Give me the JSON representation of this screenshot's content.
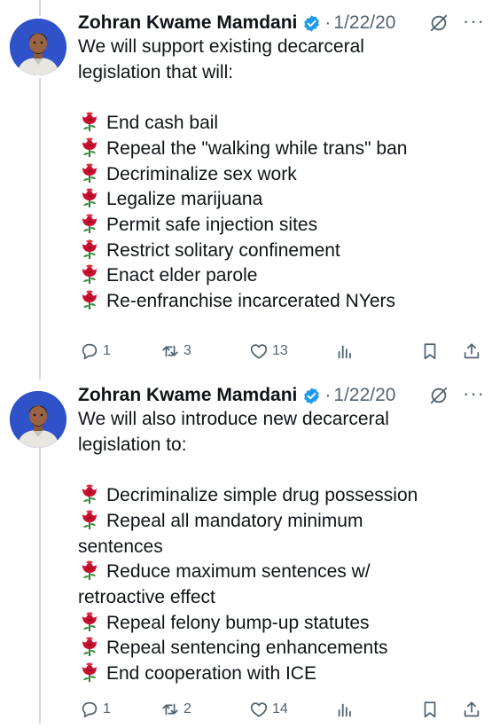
{
  "tweets": [
    {
      "author": "Zohran Kwame Mamdani",
      "date": "1/22/20",
      "separator": "·",
      "more": "···",
      "intro_lines": [
        "We will support existing decarceral",
        "legislation that will:"
      ],
      "items": [
        [
          "End cash bail"
        ],
        [
          "Repeal the \"walking while trans\" ban"
        ],
        [
          "Decriminalize sex work"
        ],
        [
          "Legalize marijuana"
        ],
        [
          "Permit safe injection sites"
        ],
        [
          "Restrict solitary confinement"
        ],
        [
          "Enact elder parole"
        ],
        [
          "Re-enfranchise incarcerated NYers"
        ]
      ],
      "replies": "1",
      "reposts": "3",
      "likes": "13"
    },
    {
      "author": "Zohran Kwame Mamdani",
      "date": "1/22/20",
      "separator": "·",
      "more": "···",
      "intro_lines": [
        "We will also introduce new decarceral",
        "legislation to:"
      ],
      "items": [
        [
          "Decriminalize simple drug possession"
        ],
        [
          "Repeal all mandatory minimum",
          "sentences"
        ],
        [
          "Reduce maximum sentences w/",
          "retroactive effect"
        ],
        [
          "Repeal felony bump-up statutes"
        ],
        [
          "Repeal sentencing enhancements"
        ],
        [
          "End cooperation with ICE"
        ]
      ],
      "replies": "1",
      "reposts": "2",
      "likes": "14"
    }
  ],
  "icons": {
    "list_bullet": "rose-emoji-icon",
    "verified": "verified-badge-icon",
    "grok": "grok-icon",
    "reply": "reply-icon",
    "repost": "repost-icon",
    "like": "heart-icon",
    "views": "analytics-icon",
    "bookmark": "bookmark-icon",
    "share": "share-icon"
  },
  "colors": {
    "text": "#0f1419",
    "secondary": "#536471",
    "verified": "#1d9bf0",
    "avatar_bg": "#2f52c8",
    "rose": "#c8102e",
    "thread_line": "#cfd9de"
  }
}
